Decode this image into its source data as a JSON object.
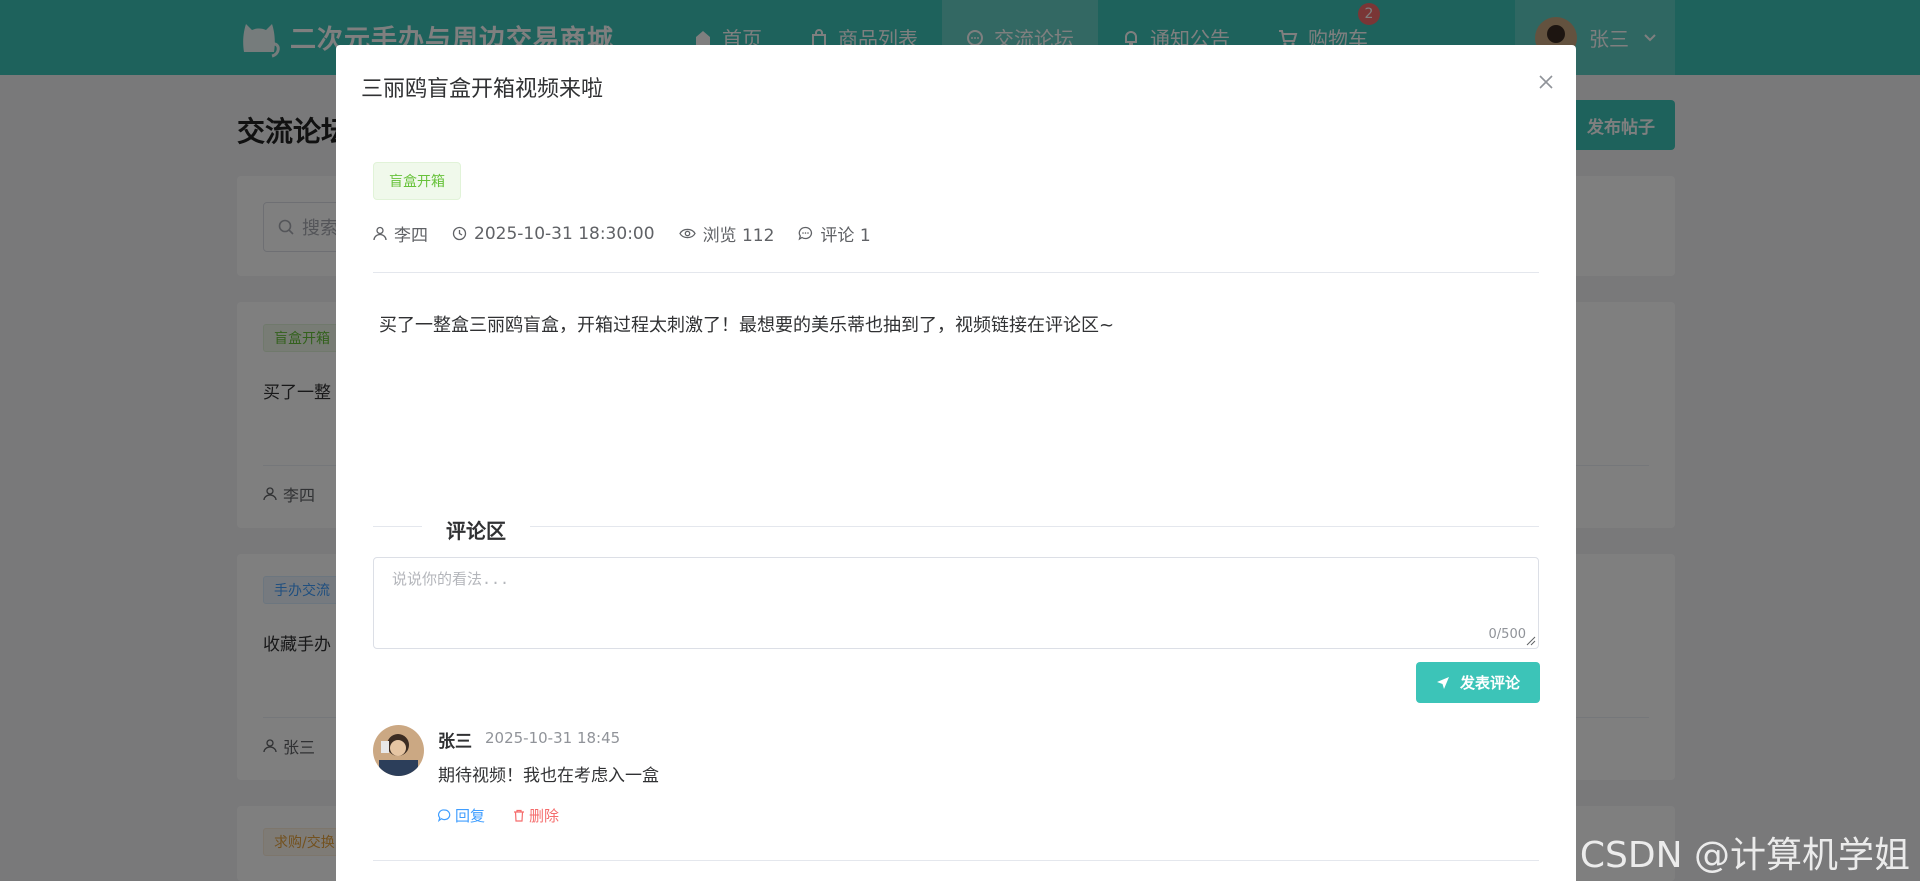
{
  "header": {
    "brand_title": "二次元手办与周边交易商城",
    "nav": [
      {
        "label": "首页",
        "icon": "home-icon"
      },
      {
        "label": "商品列表",
        "icon": "bag-icon"
      },
      {
        "label": "交流论坛",
        "icon": "chat-icon",
        "active": true
      },
      {
        "label": "通知公告",
        "icon": "bell-icon"
      },
      {
        "label": "购物车",
        "icon": "cart-icon",
        "badge": "2"
      }
    ],
    "user_name": "张三"
  },
  "forum": {
    "page_title": "交流论坛",
    "publish_label": "发布帖子",
    "search_placeholder": "搜索",
    "posts": [
      {
        "tag": "盲盒开箱",
        "excerpt": "买了一整",
        "author": "李四"
      },
      {
        "tag": "手办交流",
        "excerpt": "收藏手办",
        "author": "张三"
      },
      {
        "tag": "求购/交换"
      }
    ]
  },
  "dialog": {
    "title": "三丽鸥盲盒开箱视频来啦",
    "tag": "盲盒开箱",
    "author": "李四",
    "datetime": "2025-10-31 18:30:00",
    "views_label": "浏览 112",
    "comments_label": "评论 1",
    "content": "买了一整盒三丽鸥盲盒，开箱过程太刺激了！最想要的美乐蒂也抽到了，视频链接在评论区~",
    "comment_section_title": "评论区",
    "comment_placeholder": "说说你的看法...",
    "char_count": "0/500",
    "submit_label": "发表评论",
    "comments": [
      {
        "author": "张三",
        "time": "2025-10-31 18:45",
        "text": "期待视频！我也在考虑入一盒",
        "reply_label": "回复",
        "delete_label": "删除"
      }
    ]
  },
  "watermark": "CSDN @计算机学姐",
  "colors": {
    "primary": "#3cc4b8",
    "danger": "#f56c6c",
    "link": "#409eff",
    "success": "#67c23a"
  }
}
